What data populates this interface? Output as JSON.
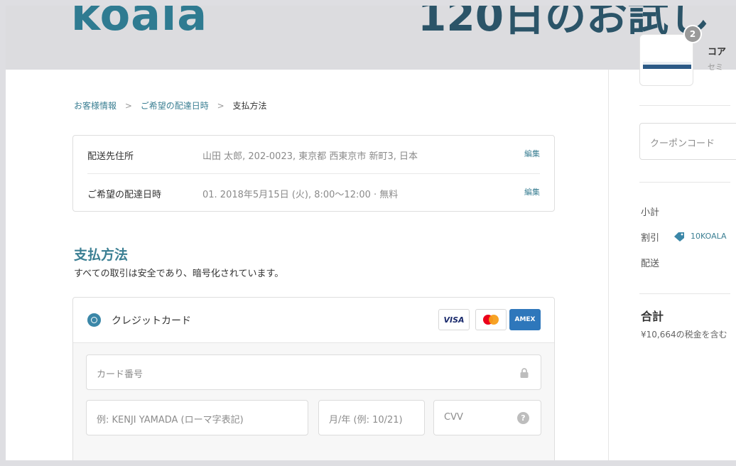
{
  "header": {
    "logo": "koala",
    "hero_text": "120日のお試し"
  },
  "breadcrumb": [
    {
      "label": "お客様情報"
    },
    {
      "label": "ご希望の配達日時"
    },
    {
      "label": "支払方法"
    }
  ],
  "breadcrumb_separator": ">",
  "summary": {
    "rows": [
      {
        "label": "配送先住所",
        "value": "山田 太郎, 202-0023, 東京都 西東京市 新町3, 日本",
        "edit": "編集"
      },
      {
        "label": "ご希望の配達日時",
        "value": "01. 2018年5月15日 (火), 8:00〜12:00 · 無料",
        "edit": "編集"
      }
    ]
  },
  "payment": {
    "title": "支払方法",
    "subtitle": "すべての取引は安全であり、暗号化されています。",
    "method_label": "クレジットカード",
    "card_brands": [
      "VISA",
      "mastercard",
      "AMEX"
    ],
    "fields": {
      "card_number": "カード番号",
      "name": "例: KENJI YAMADA (ローマ字表記)",
      "expiry": "月/年 (例: 10/21)",
      "cvv": "CVV"
    },
    "help_symbol": "?"
  },
  "cart": {
    "quantity": "2",
    "product_name": "コア",
    "product_sub": "セミ",
    "coupon_placeholder": "クーポンコード",
    "subtotal_label": "小計",
    "discount_label": "割引",
    "discount_code": "10KOALA",
    "shipping_label": "配送",
    "total_label": "合計",
    "tax_note": "¥10,664の税金を含む"
  },
  "colors": {
    "brand_teal": "#3b7f93",
    "logo_teal": "#2f7b91",
    "hero_navy": "#2b5468",
    "radio_blue": "#3b87a8"
  }
}
